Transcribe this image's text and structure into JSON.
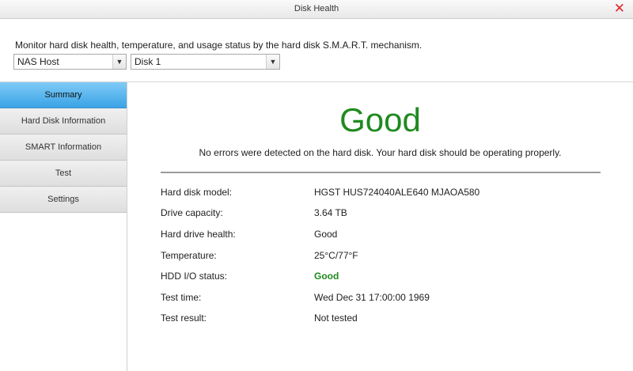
{
  "window": {
    "title": "Disk Health",
    "close_icon": "close-icon",
    "close_glyph": "✕"
  },
  "description": "Monitor hard disk health, temperature, and usage status by the hard disk S.M.A.R.T. mechanism.",
  "selectors": {
    "host": "NAS Host",
    "disk": "Disk 1",
    "arrow": "▼"
  },
  "sidebar": {
    "items": [
      {
        "label": "Summary",
        "active": true
      },
      {
        "label": "Hard Disk Information",
        "active": false
      },
      {
        "label": "SMART Information",
        "active": false
      },
      {
        "label": "Test",
        "active": false
      },
      {
        "label": "Settings",
        "active": false
      }
    ]
  },
  "summary": {
    "status": "Good",
    "status_color": "#1f8a1f",
    "message": "No errors were detected on the hard disk. Your hard disk should be operating properly.",
    "details": [
      {
        "label": "Hard disk model:",
        "value": "HGST HUS724040ALE640 MJAOA580"
      },
      {
        "label": "Drive capacity:",
        "value": "3.64 TB"
      },
      {
        "label": "Hard drive health:",
        "value": "Good"
      },
      {
        "label": "Temperature:",
        "value": "25°C/77°F"
      },
      {
        "label": "HDD I/O status:",
        "value": "Good"
      },
      {
        "label": "Test time:",
        "value": "Wed Dec 31 17:00:00 1969"
      },
      {
        "label": "Test result:",
        "value": "Not tested"
      }
    ]
  }
}
